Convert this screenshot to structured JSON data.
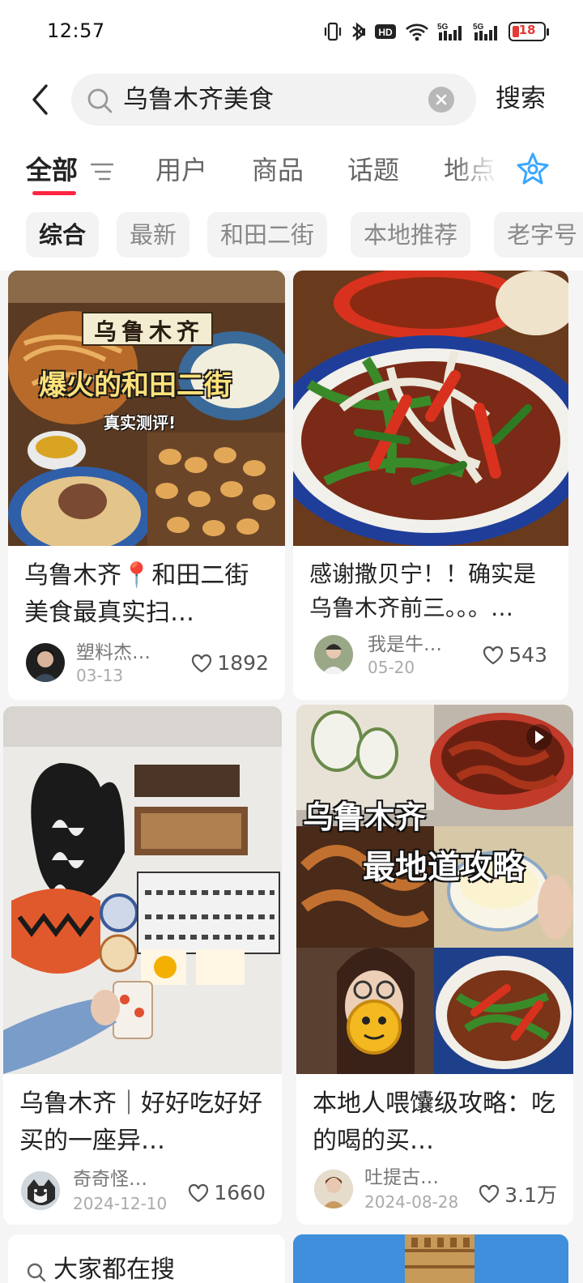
{
  "status": {
    "time": "12:57",
    "battery": "18"
  },
  "search": {
    "query": "乌鲁木齐美食",
    "button_label": "搜索"
  },
  "tabs": [
    {
      "label": "全部",
      "active": true
    },
    {
      "label": "用户",
      "active": false
    },
    {
      "label": "商品",
      "active": false
    },
    {
      "label": "话题",
      "active": false
    },
    {
      "label": "地点",
      "active": false
    }
  ],
  "chips": [
    {
      "label": "综合",
      "active": true
    },
    {
      "label": "最新",
      "active": false
    },
    {
      "label": "和田二街",
      "active": false
    },
    {
      "label": "本地推荐",
      "active": false
    },
    {
      "label": "老字号",
      "active": false
    }
  ],
  "posts": [
    {
      "title": "乌鲁木齐📍和田二街美食最真实扫…",
      "author": "塑料杰…",
      "date": "03-13",
      "likes": "1892",
      "image_caption_top": "乌鲁木齐",
      "image_caption_main": "爆火的和田二街",
      "image_caption_sub": "真实测评!"
    },
    {
      "title": "感谢撒贝宁！！确实是乌鲁木齐前三。。。…",
      "author": "我是牛…",
      "date": "05-20",
      "likes": "543"
    },
    {
      "title": "乌鲁木齐｜好好吃好好买的一座异…",
      "author": "奇奇怪…",
      "date": "2024-12-10",
      "likes": "1660"
    },
    {
      "title": "本地人喂馕级攻略：吃的喝的买…",
      "author": "吐提古…",
      "date": "2024-08-28",
      "likes": "3.1万",
      "image_caption_top": "乌鲁木齐",
      "image_caption_main": "最地道攻略"
    },
    {
      "title": "大家都在搜"
    }
  ]
}
